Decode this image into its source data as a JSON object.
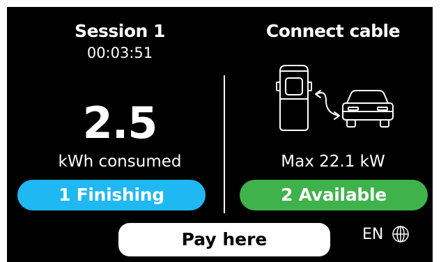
{
  "session": {
    "title": "Session 1",
    "timer": "00:03:51",
    "energy_value": "2.5",
    "energy_label": "kWh consumed"
  },
  "connector": {
    "title": "Connect cable",
    "max_power": "Max 22.1 kW",
    "illustration_icon": "charger-to-car-icon"
  },
  "statuses": {
    "left": {
      "label": "1 Finishing",
      "color": "#1fb8f2"
    },
    "right": {
      "label": "2 Available",
      "color": "#3fb24b"
    }
  },
  "footer": {
    "pay_label": "Pay here",
    "language": "EN",
    "language_icon": "globe-icon"
  },
  "colors": {
    "background": "#000000",
    "text": "#ffffff"
  }
}
